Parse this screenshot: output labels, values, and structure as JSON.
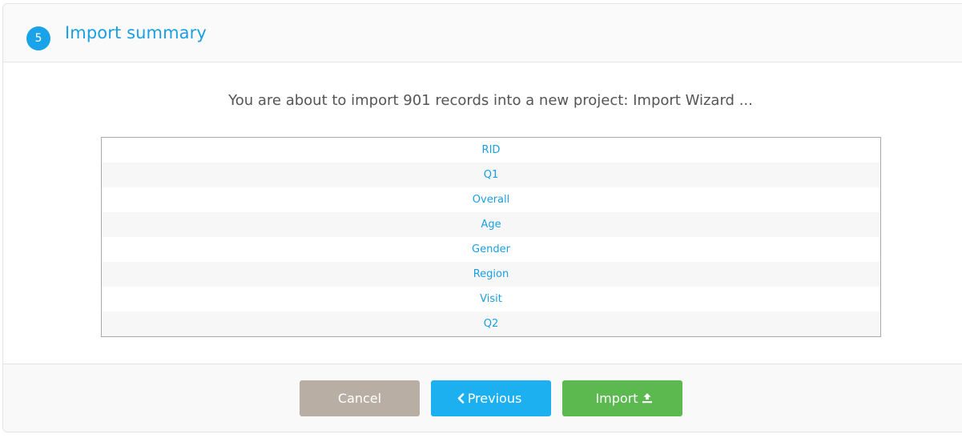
{
  "header": {
    "step_number": "5",
    "title": "Import summary"
  },
  "summary": {
    "message": "You are about to import 901 records into a new project: Import Wizard ..."
  },
  "fields": [
    "RID",
    "Q1",
    "Overall",
    "Age",
    "Gender",
    "Region",
    "Visit",
    "Q2"
  ],
  "footer": {
    "cancel_label": "Cancel",
    "previous_label": "Previous",
    "import_label": "Import"
  },
  "colors": {
    "accent": "#1a9fe3",
    "cancel": "#b8aea3",
    "previous": "#1db0f0",
    "import": "#5bb950"
  },
  "icons": {
    "previous": "chevron-left-icon",
    "import": "upload-icon"
  }
}
